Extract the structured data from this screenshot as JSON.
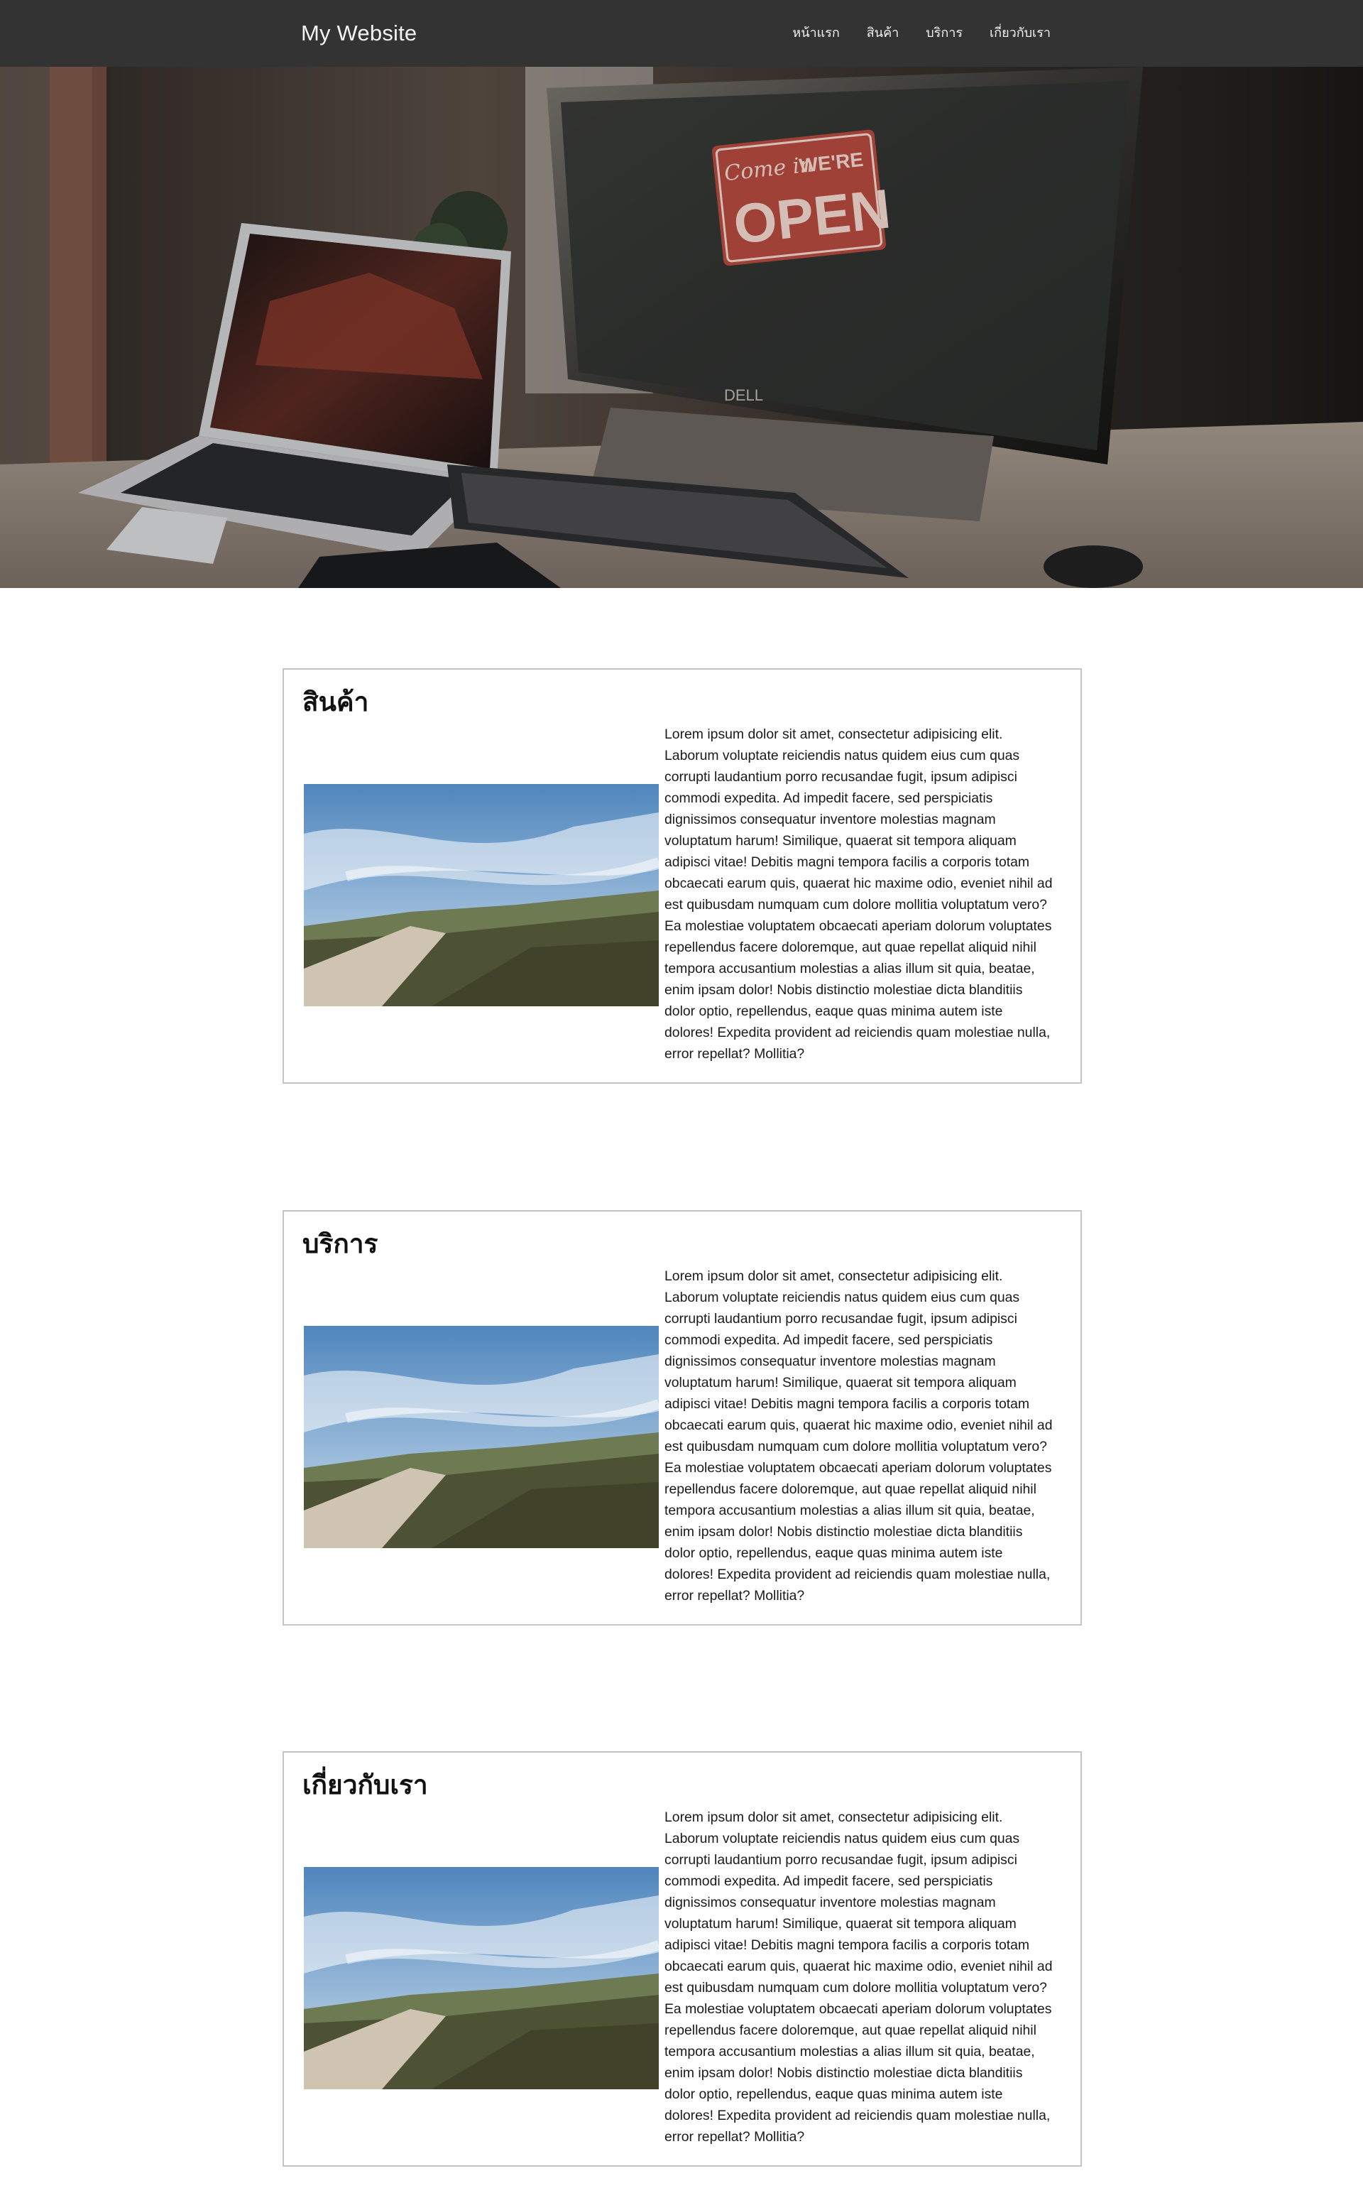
{
  "navbar": {
    "brand": "My Website",
    "links": [
      "หน้าแรก",
      "สินค้า",
      "บริการ",
      "เกี่ยวกับเรา"
    ]
  },
  "hero": {
    "sign_script": "Come in",
    "sign_were": "WE'RE",
    "sign_open": "OPEN",
    "monitor_brand": "DELL"
  },
  "sections": [
    {
      "title": "สินค้า",
      "body": "Lorem ipsum dolor sit amet, consectetur adipisicing elit. Laborum voluptate reiciendis natus quidem eius cum quas corrupti laudantium porro recusandae fugit, ipsum adipisci commodi expedita. Ad impedit facere, sed perspiciatis dignissimos consequatur inventore molestias magnam voluptatum harum! Similique, quaerat sit tempora aliquam adipisci vitae! Debitis magni tempora facilis a corporis totam obcaecati earum quis, quaerat hic maxime odio, eveniet nihil ad est quibusdam numquam cum dolore mollitia voluptatum vero? Ea molestiae voluptatem obcaecati aperiam dolorum voluptates repellendus facere doloremque, aut quae repellat aliquid nihil tempora accusantium molestias a alias illum sit quia, beatae, enim ipsam dolor! Nobis distinctio molestiae dicta blanditiis dolor optio, repellendus, eaque quas minima autem iste dolores! Expedita provident ad reiciendis quam molestiae nulla, error repellat? Mollitia?"
    },
    {
      "title": "บริการ",
      "body": "Lorem ipsum dolor sit amet, consectetur adipisicing elit. Laborum voluptate reiciendis natus quidem eius cum quas corrupti laudantium porro recusandae fugit, ipsum adipisci commodi expedita. Ad impedit facere, sed perspiciatis dignissimos consequatur inventore molestias magnam voluptatum harum! Similique, quaerat sit tempora aliquam adipisci vitae! Debitis magni tempora facilis a corporis totam obcaecati earum quis, quaerat hic maxime odio, eveniet nihil ad est quibusdam numquam cum dolore mollitia voluptatum vero? Ea molestiae voluptatem obcaecati aperiam dolorum voluptates repellendus facere doloremque, aut quae repellat aliquid nihil tempora accusantium molestias a alias illum sit quia, beatae, enim ipsam dolor! Nobis distinctio molestiae dicta blanditiis dolor optio, repellendus, eaque quas minima autem iste dolores! Expedita provident ad reiciendis quam molestiae nulla, error repellat? Mollitia?"
    },
    {
      "title": "เกี่ยวกับเรา",
      "body": "Lorem ipsum dolor sit amet, consectetur adipisicing elit. Laborum voluptate reiciendis natus quidem eius cum quas corrupti laudantium porro recusandae fugit, ipsum adipisci commodi expedita. Ad impedit facere, sed perspiciatis dignissimos consequatur inventore molestias magnam voluptatum harum! Similique, quaerat sit tempora aliquam adipisci vitae! Debitis magni tempora facilis a corporis totam obcaecati earum quis, quaerat hic maxime odio, eveniet nihil ad est quibusdam numquam cum dolore mollitia voluptatum vero? Ea molestiae voluptatem obcaecati aperiam dolorum voluptates repellendus facere doloremque, aut quae repellat aliquid nihil tempora accusantium molestias a alias illum sit quia, beatae, enim ipsam dolor! Nobis distinctio molestiae dicta blanditiis dolor optio, repellendus, eaque quas minima autem iste dolores! Expedita provident ad reiciendis quam molestiae nulla, error repellat? Mollitia?"
    }
  ]
}
